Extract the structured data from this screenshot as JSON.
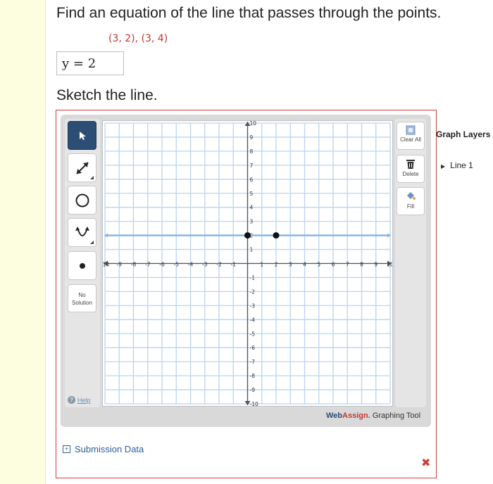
{
  "question": {
    "prompt": "Find an equation of the line that passes through the points.",
    "points": "(3, 2), (3, 4)",
    "answer": "y = 2",
    "sketch_label": "Sketch the line."
  },
  "toolbar": {
    "tools": [
      "pointer",
      "line",
      "circle",
      "parabola",
      "point"
    ],
    "no_solution_line1": "No",
    "no_solution_line2": "Solution",
    "help_label": "Help"
  },
  "actions": {
    "clear_all": "Clear All",
    "delete": "Delete",
    "fill": "Fill"
  },
  "layers": {
    "title": "Graph Layers",
    "items": [
      "Line 1"
    ]
  },
  "graph": {
    "x_range": [
      -10,
      10
    ],
    "y_range": [
      -10,
      10
    ],
    "x_ticks": [
      "-10",
      "-9",
      "-8",
      "-7",
      "-6",
      "-5",
      "-4",
      "-3",
      "-2",
      "-1",
      "1",
      "2",
      "3",
      "4",
      "5",
      "6",
      "7",
      "8",
      "9",
      "10"
    ],
    "y_ticks": [
      "10",
      "9",
      "8",
      "7",
      "6",
      "5",
      "4",
      "3",
      "2",
      "1",
      "-1",
      "-2",
      "-3",
      "-4",
      "-5",
      "-6",
      "-7",
      "-8",
      "-9",
      "-10"
    ],
    "line_y": 2,
    "points": [
      [
        0,
        2
      ],
      [
        2,
        2
      ]
    ],
    "line_color": "#8ab4e8",
    "grid_color": "#b9d4ef",
    "point_color": "#111111"
  },
  "branding": {
    "web": "Web",
    "assign": "Assign.",
    "rest": " Graphing Tool"
  },
  "submission": {
    "label": "Submission Data",
    "expand_icon": "plus-box-icon"
  },
  "colors": {
    "frame_border": "#d23b3b",
    "active_tool": "#2c4d74",
    "points_text": "#c0392b"
  }
}
